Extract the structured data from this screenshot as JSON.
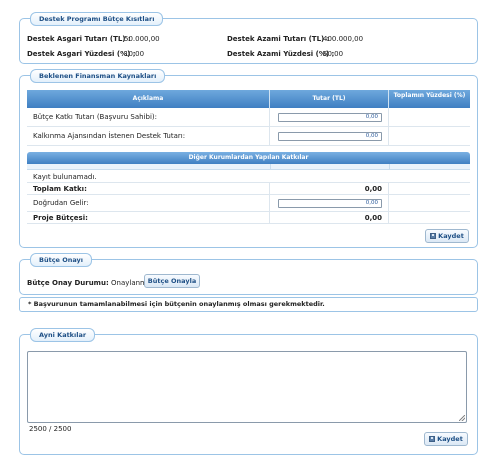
{
  "kisitlar": {
    "legend": "Destek Programı Bütçe Kısıtları",
    "min_tutar_label": "Destek Asgari Tutarı (TL) :",
    "min_tutar_value": "50.000,00",
    "max_tutar_label": "Destek Azami Tutarı (TL) :",
    "max_tutar_value": "400.000,00",
    "min_yuzde_label": "Destek Asgari Yüzdesi (%) :",
    "min_yuzde_value": "10,00",
    "max_yuzde_label": "Destek Azami Yüzdesi (%) :",
    "max_yuzde_value": "50,00"
  },
  "kaynaklar": {
    "legend": "Beklenen Finansman Kaynakları",
    "headers": {
      "aciklama": "Açıklama",
      "tutar": "Tutar (TL)",
      "yuzde": "Toplamın Yüzdesi (%)"
    },
    "rows": [
      {
        "label": "Bütçe Katkı Tutarı (Başvuru Sahibi):",
        "value": "0,00"
      },
      {
        "label": "Kalkınma Ajansından İstenen Destek Tutarı:",
        "value": "0,00"
      }
    ],
    "diger_header": "Diğer Kurumlardan Yapılan Katkılar",
    "no_record": "Kayıt bulunamadı.",
    "toplam_label": "Toplam Katkı:",
    "toplam_value": "0,00",
    "dogrudan_label": "Doğrudan Gelir:",
    "dogrudan_value": "0,00",
    "proje_label": "Proje Bütçesi:",
    "proje_value": "0,00",
    "save_label": "Kaydet"
  },
  "onay": {
    "legend": "Bütçe Onayı",
    "durum_label": "Bütçe Onay Durumu:",
    "durum_value": "Onaylanmadı",
    "button_label": "Bütçe Onayla"
  },
  "warning": "* Başvurunun tamamlanabilmesi için bütçenin onaylanmış olması gerekmektedir.",
  "ayni": {
    "legend": "Ayni Katkılar",
    "counter": "2500 / 2500",
    "save_label": "Kaydet"
  }
}
